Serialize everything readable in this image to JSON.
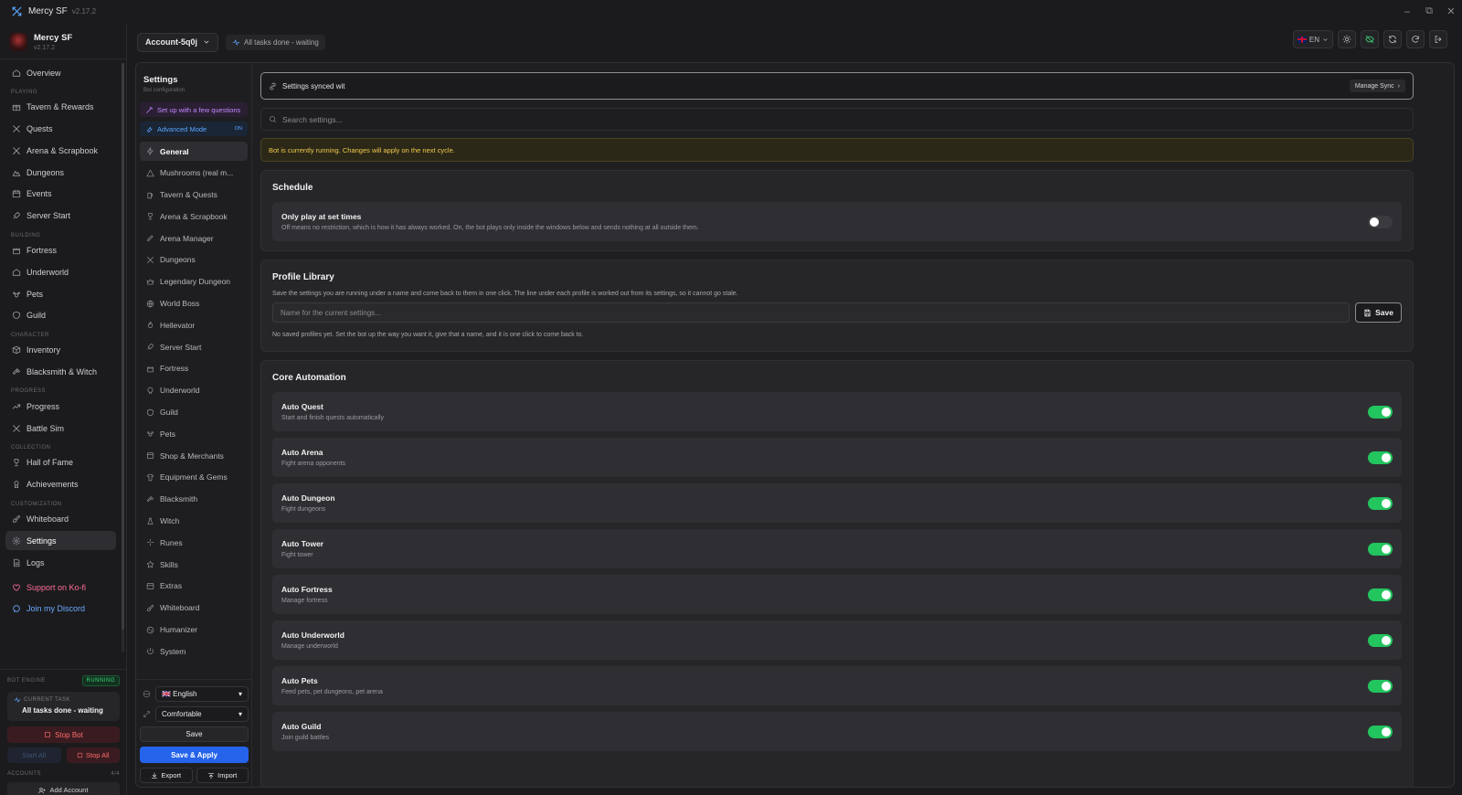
{
  "window": {
    "app_name": "Mercy SF",
    "version": "v2.17.2",
    "minimize": "–",
    "maximize": "⧉",
    "close": "✕"
  },
  "brand": {
    "name": "Mercy SF",
    "version": "v2.17.2"
  },
  "sidebar": {
    "overview": "Overview",
    "sections": {
      "playing": "PLAYING",
      "building": "BUILDING",
      "character": "CHARACTER",
      "progress": "PROGRESS",
      "collection": "COLLECTION",
      "customization": "CUSTOMIZATION"
    },
    "items": {
      "tavern": "Tavern & Rewards",
      "quests": "Quests",
      "arena": "Arena & Scrapbook",
      "dungeons": "Dungeons",
      "events": "Events",
      "server_start": "Server Start",
      "fortress": "Fortress",
      "underworld": "Underworld",
      "pets": "Pets",
      "guild": "Guild",
      "inventory": "Inventory",
      "blacksmith": "Blacksmith & Witch",
      "progress": "Progress",
      "battle_sim": "Battle Sim",
      "hall_of_fame": "Hall of Fame",
      "achievements": "Achievements",
      "whiteboard": "Whiteboard",
      "settings": "Settings",
      "logs": "Logs"
    },
    "kofi": "Support on Ko-fi",
    "discord": "Join my Discord"
  },
  "engine": {
    "label": "BOT ENGINE",
    "status": "RUNNING",
    "current_task_label": "CURRENT TASK",
    "current_task": "All tasks done - waiting",
    "stop_bot": "Stop Bot",
    "start_all": "Start All",
    "stop_all": "Stop All",
    "accounts_label": "ACCOUNTS",
    "accounts_count": "4/4",
    "add_account": "Add Account"
  },
  "header": {
    "account": "Account-5q0j",
    "status": "All tasks done - waiting",
    "language": "EN"
  },
  "settings_nav": {
    "title": "Settings",
    "subtitle": "Bot configuration",
    "setup": "Set up with a few questions",
    "advanced": "Advanced Mode",
    "advanced_state": "ON",
    "items": [
      "General",
      "Mushrooms (real m...",
      "Tavern & Quests",
      "Arena & Scrapbook",
      "Arena Manager",
      "Dungeons",
      "Legendary Dungeon",
      "World Boss",
      "Hellevator",
      "Server Start",
      "Fortress",
      "Underworld",
      "Guild",
      "Pets",
      "Shop & Merchants",
      "Equipment & Gems",
      "Blacksmith",
      "Witch",
      "Runes",
      "Skills",
      "Extras",
      "Whiteboard",
      "Humanizer",
      "System"
    ],
    "language_select": "🇬🇧 English",
    "density_select": "Comfortable",
    "save": "Save",
    "save_apply": "Save & Apply",
    "export": "Export",
    "import": "Import"
  },
  "content": {
    "sync_text": "Settings synced wit",
    "manage_sync": "Manage Sync",
    "search_placeholder": "Search settings...",
    "warning": "Bot is currently running. Changes will apply on the next cycle.",
    "schedule": {
      "title": "Schedule",
      "row_title": "Only play at set times",
      "row_desc": "Off means no restriction, which is how it has always worked. On, the bot plays only inside the windows below and sends nothing at all outside them."
    },
    "profile": {
      "title": "Profile Library",
      "desc": "Save the settings you are running under a name and come back to them in one click. The line under each profile is worked out from its settings, so it cannot go stale.",
      "placeholder": "Name for the current settings...",
      "save": "Save",
      "empty": "No saved profiles yet. Set the bot up the way you want it, give that a name, and it is one click to come back to."
    },
    "core": {
      "title": "Core Automation",
      "rows": [
        {
          "title": "Auto Quest",
          "desc": "Start and finish quests automatically"
        },
        {
          "title": "Auto Arena",
          "desc": "Fight arena opponents"
        },
        {
          "title": "Auto Dungeon",
          "desc": "Fight dungeons"
        },
        {
          "title": "Auto Tower",
          "desc": "Fight tower"
        },
        {
          "title": "Auto Fortress",
          "desc": "Manage fortress"
        },
        {
          "title": "Auto Underworld",
          "desc": "Manage underworld"
        },
        {
          "title": "Auto Pets",
          "desc": "Feed pets, pet dungeons, pet arena"
        },
        {
          "title": "Auto Guild",
          "desc": "Join guild battles"
        }
      ]
    }
  },
  "colors": {
    "accent": "#2563eb",
    "toggle_on": "#22c55e",
    "warning": "#f2c94c",
    "danger": "#ff6b6b",
    "kofi": "#ff6b9a",
    "discord": "#6aa8ff"
  }
}
